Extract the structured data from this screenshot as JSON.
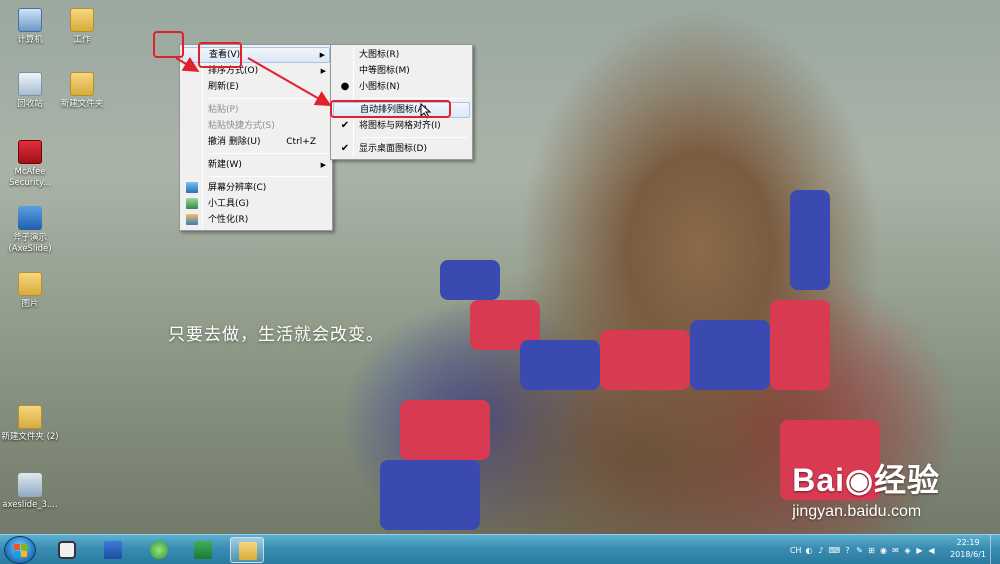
{
  "desktop_icons": [
    {
      "label": "计算机",
      "icon": "computer-icon"
    },
    {
      "label": "工作",
      "icon": "folder-icon"
    },
    {
      "label": "回收站",
      "icon": "recycle-bin-icon"
    },
    {
      "label": "新建文件夹",
      "icon": "folder-icon"
    },
    {
      "label": "McAfee Security...",
      "icon": "mcafee-icon"
    },
    {
      "label": "斧子演示 (AxeSlide)",
      "icon": "axeslide-icon"
    },
    {
      "label": "图片",
      "icon": "folder-icon"
    },
    {
      "label": "新建文件夹 (2)",
      "icon": "folder-icon"
    },
    {
      "label": "axeslide_3....",
      "icon": "installer-icon"
    }
  ],
  "slogan": "只要去做，生活就会改变。",
  "context_menu": {
    "view": "查看(V)",
    "sort": "排序方式(O)",
    "refresh": "刷新(E)",
    "paste": "粘贴(P)",
    "paste_shortcut": "粘贴快捷方式(S)",
    "undo": "撤消 删除(U)",
    "undo_shortcut": "Ctrl+Z",
    "new": "新建(W)",
    "resolution": "屏幕分辨率(C)",
    "gadgets": "小工具(G)",
    "personalize": "个性化(R)"
  },
  "view_submenu": {
    "large": "大图标(R)",
    "medium": "中等图标(M)",
    "small": "小图标(N)",
    "auto_arrange": "自动排列图标(A)",
    "align_grid": "将图标与网格对齐(I)",
    "show_icons": "显示桌面图标(D)",
    "selected_size": "small",
    "checked": [
      "align_grid",
      "show_icons"
    ]
  },
  "taskbar": {
    "tray_items": [
      "CH",
      "◐",
      "♪",
      "⌨",
      "?",
      "✎",
      "⊞",
      "◉",
      "✉",
      "◈",
      "▶",
      "◀"
    ],
    "time": "22:19",
    "date": "2018/6/1"
  },
  "watermark": {
    "brand": "Bai◉经验",
    "url": "jingyan.baidu.com"
  },
  "colors": {
    "annotation_red": "#e0202a",
    "taskbar": "#3a8db2",
    "menu_bg": "#f0f0f0"
  }
}
